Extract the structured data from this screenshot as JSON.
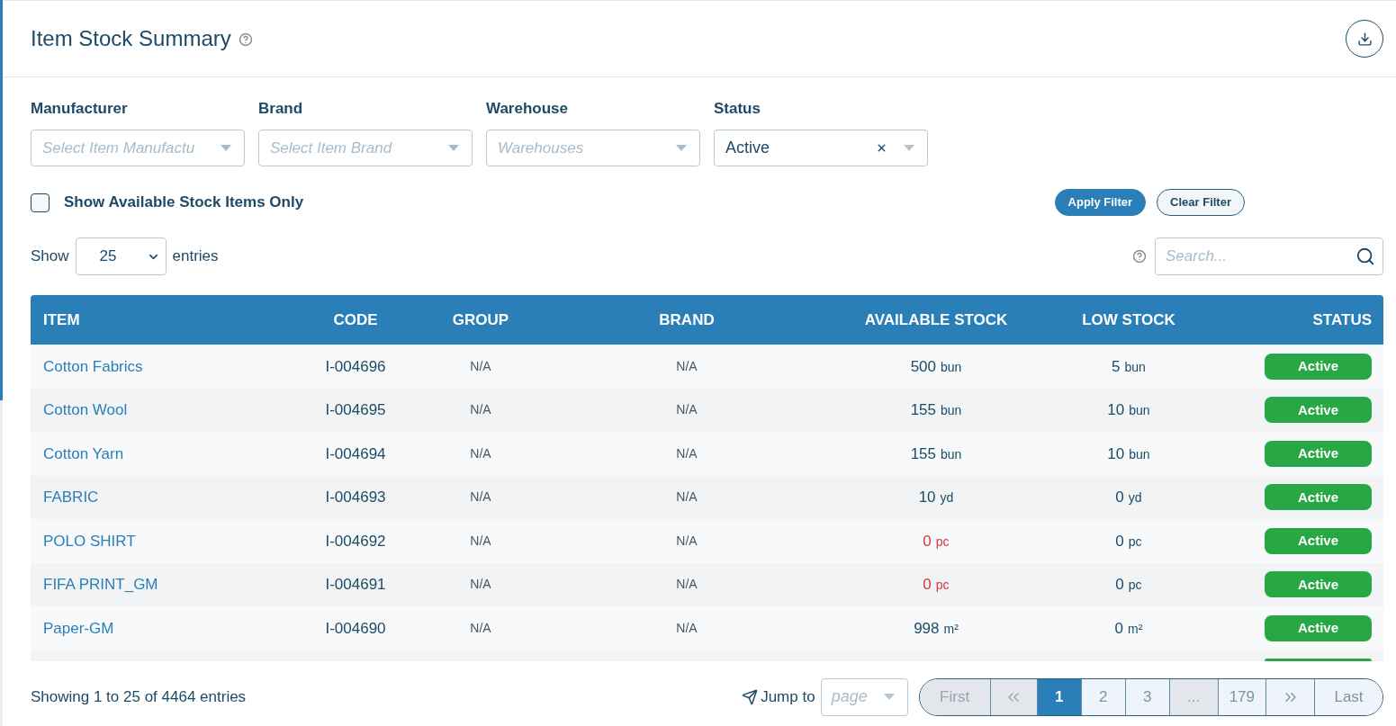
{
  "header": {
    "title": "Item Stock Summary"
  },
  "filters": [
    {
      "label": "Manufacturer",
      "placeholder": "Select Item Manufactu"
    },
    {
      "label": "Brand",
      "placeholder": "Select Item Brand"
    },
    {
      "label": "Warehouse",
      "placeholder": "Warehouses"
    },
    {
      "label": "Status",
      "value": "Active"
    }
  ],
  "available_only": {
    "label": "Show Available Stock Items Only",
    "checked": false
  },
  "filter_buttons": [
    {
      "label": "Apply Filter",
      "kind": "primary"
    },
    {
      "label": "Clear Filter",
      "kind": "outline"
    }
  ],
  "page_length": {
    "label_before": "Show",
    "value": "25",
    "label_after": "entries"
  },
  "search": {
    "placeholder": "Search..."
  },
  "table": {
    "columns": [
      "ITEM",
      "CODE",
      "GROUP",
      "BRAND",
      "AVAILABLE STOCK",
      "LOW STOCK",
      "STATUS"
    ],
    "rows": [
      {
        "item": "Cotton Fabrics",
        "code": "I-004696",
        "group": "N/A",
        "brand": "N/A",
        "available": {
          "value": "500",
          "unit": "bun",
          "low": false
        },
        "low_stock": {
          "value": "5",
          "unit": "bun"
        },
        "status": "Active"
      },
      {
        "item": "Cotton Wool",
        "code": "I-004695",
        "group": "N/A",
        "brand": "N/A",
        "available": {
          "value": "155",
          "unit": "bun",
          "low": false
        },
        "low_stock": {
          "value": "10",
          "unit": "bun"
        },
        "status": "Active"
      },
      {
        "item": "Cotton Yarn",
        "code": "I-004694",
        "group": "N/A",
        "brand": "N/A",
        "available": {
          "value": "155",
          "unit": "bun",
          "low": false
        },
        "low_stock": {
          "value": "10",
          "unit": "bun"
        },
        "status": "Active"
      },
      {
        "item": "FABRIC",
        "code": "I-004693",
        "group": "N/A",
        "brand": "N/A",
        "available": {
          "value": "10",
          "unit": "yd",
          "low": false
        },
        "low_stock": {
          "value": "0",
          "unit": "yd"
        },
        "status": "Active"
      },
      {
        "item": "POLO SHIRT",
        "code": "I-004692",
        "group": "N/A",
        "brand": "N/A",
        "available": {
          "value": "0",
          "unit": "pc",
          "low": true
        },
        "low_stock": {
          "value": "0",
          "unit": "pc"
        },
        "status": "Active"
      },
      {
        "item": "FIFA PRINT_GM",
        "code": "I-004691",
        "group": "N/A",
        "brand": "N/A",
        "available": {
          "value": "0",
          "unit": "pc",
          "low": true
        },
        "low_stock": {
          "value": "0",
          "unit": "pc"
        },
        "status": "Active"
      },
      {
        "item": "Paper-GM",
        "code": "I-004690",
        "group": "N/A",
        "brand": "N/A",
        "available": {
          "value": "998",
          "unit": "m²",
          "low": false
        },
        "low_stock": {
          "value": "0",
          "unit": "m²"
        },
        "status": "Active"
      }
    ]
  },
  "footer": {
    "info": "Showing 1 to 25 of 4464 entries",
    "jump": {
      "label": "Jump to",
      "placeholder": "page"
    },
    "pagination": [
      {
        "kind": "first",
        "label": "First",
        "selected": false,
        "disabled": true
      },
      {
        "kind": "prev",
        "selected": false,
        "disabled": true
      },
      {
        "kind": "page",
        "label": "1",
        "selected": true,
        "disabled": false
      },
      {
        "kind": "page",
        "label": "2",
        "selected": false,
        "disabled": false
      },
      {
        "kind": "page",
        "label": "3",
        "selected": false,
        "disabled": false
      },
      {
        "kind": "ellipsis",
        "label": "...",
        "selected": false,
        "disabled": true
      },
      {
        "kind": "page",
        "label": "179",
        "selected": false,
        "disabled": false
      },
      {
        "kind": "next",
        "selected": false,
        "disabled": false
      },
      {
        "kind": "last",
        "label": "Last",
        "selected": false,
        "disabled": false
      }
    ]
  }
}
